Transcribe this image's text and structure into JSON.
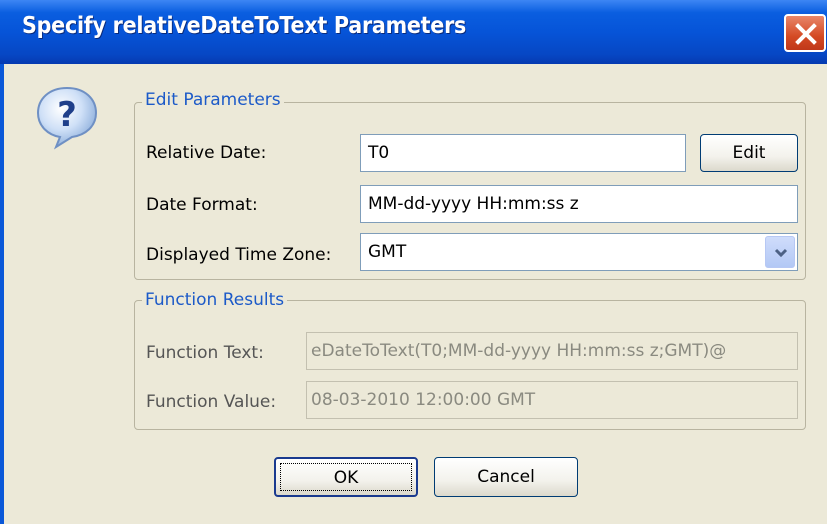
{
  "window": {
    "title": "Specify relativeDateToText Parameters"
  },
  "icons": {
    "dialog": "question-icon",
    "close": "close-icon",
    "dropdown": "chevron-down-icon"
  },
  "edit_parameters": {
    "legend": "Edit Parameters",
    "relative_date": {
      "label": "Relative Date:",
      "value": "T0",
      "edit_button": "Edit"
    },
    "date_format": {
      "label": "Date Format:",
      "value": "MM-dd-yyyy HH:mm:ss z"
    },
    "time_zone": {
      "label": "Displayed Time Zone:",
      "value": "GMT"
    }
  },
  "function_results": {
    "legend": "Function Results",
    "function_text": {
      "label": "Function Text:",
      "value": "eDateToText(T0;MM-dd-yyyy HH:mm:ss z;GMT)@"
    },
    "function_value": {
      "label": "Function Value:",
      "value": "08-03-2010 12:00:00 GMT"
    }
  },
  "buttons": {
    "ok": "OK",
    "cancel": "Cancel"
  },
  "colors": {
    "titlebar": "#0654d8",
    "legend_text": "#1c5ac8",
    "close_button": "#d44a24",
    "dialog_bg": "#ece9d8"
  }
}
